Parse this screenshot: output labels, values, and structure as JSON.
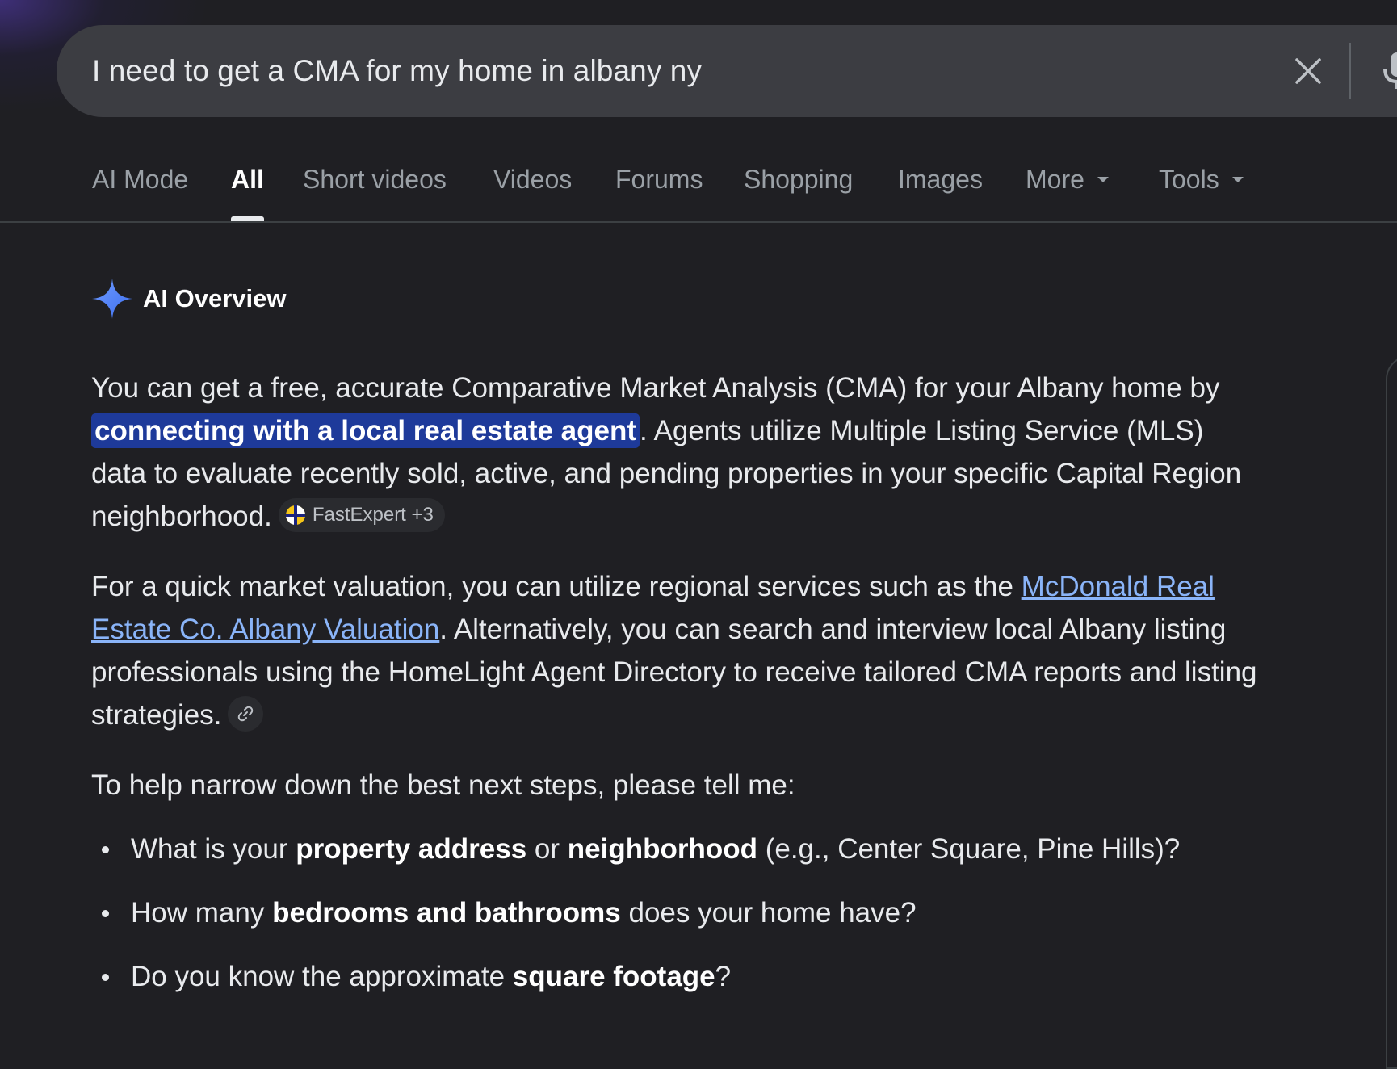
{
  "search": {
    "query": "I need to get a CMA for my home in albany ny",
    "clear_icon": "close-icon",
    "mic_icon": "microphone-icon"
  },
  "tabs": [
    {
      "label": "AI Mode"
    },
    {
      "label": "All",
      "active": true
    },
    {
      "label": "Short videos"
    },
    {
      "label": "Videos"
    },
    {
      "label": "Forums"
    },
    {
      "label": "Shopping"
    },
    {
      "label": "Images"
    },
    {
      "label": "More"
    },
    {
      "label": "Tools"
    }
  ],
  "ai_overview": {
    "title": "AI Overview",
    "icon": "sparkle-icon",
    "accent_color": "#4f7df5",
    "p1": {
      "text1": "You can get a free, accurate Comparative Market Analysis (CMA) for your Albany home by ",
      "highlight": "connecting with a local real estate agent",
      "text2": ". Agents utilize Multiple Listing Service (MLS) data to evaluate recently sold, active, and pending properties in your specific Capital Region neighborhood.",
      "source_chip": "FastExpert +3"
    },
    "p2": {
      "text1": "For a quick market valuation, you can utilize regional services such as the ",
      "link": "McDonald Real Estate Co. Albany Valuation",
      "text2": ". Alternatively, you can search and interview local Albany listing professionals using the HomeLight Agent Directory to receive tailored CMA reports and listing strategies.",
      "link_icon": "link-icon"
    },
    "p3": "To help narrow down the best next steps, please tell me:",
    "questions": [
      {
        "pre": "What is your ",
        "b1": "property address",
        "mid": " or ",
        "b2": "neighborhood",
        "post": " (e.g., Center Square, Pine Hills)?"
      },
      {
        "pre": "How many ",
        "b1": "bedrooms and bathrooms",
        "post": " does your home have?"
      },
      {
        "pre": "Do you know the approximate ",
        "b1": "square footage",
        "post": "?"
      }
    ]
  }
}
